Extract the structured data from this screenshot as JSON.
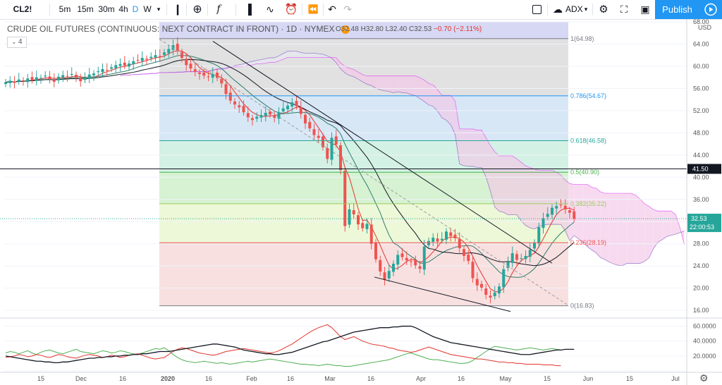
{
  "toolbar": {
    "symbol": "CL2!",
    "intervals": [
      "5m",
      "15m",
      "30m",
      "4h",
      "D",
      "W"
    ],
    "active_interval": "D",
    "compare_label": "ADX",
    "publish_label": "Publish"
  },
  "legend": {
    "title": "CRUDE OIL FUTURES (CONTINUOUS: NEXT CONTRACT IN FRONT) · 1D · NYMEX",
    "badge": "D",
    "o": "O32.48",
    "h": "H32.80",
    "l": "L32.40",
    "c": "C32.53",
    "change": "−0.70 (−2.11%)",
    "indicator_count": "4"
  },
  "price_axis": {
    "currency": "USD",
    "last_price": "32.53",
    "countdown": "22:00:53",
    "hline_price": "41.50"
  },
  "colors": {
    "up": "#26a69a",
    "down": "#ef5350",
    "accent": "#2196f3",
    "cloud_bear": "#f3c6e6",
    "cloud_bull": "#e8e8f2"
  },
  "chart_data": {
    "type": "candlestick",
    "title": "CRUDE OIL FUTURES (CONTINUOUS: NEXT CONTRACT IN FRONT)",
    "ylim": [
      15,
      68
    ],
    "y_ticks": [
      "68.00",
      "64.00",
      "60.00",
      "56.00",
      "52.00",
      "48.00",
      "44.00",
      "40.00",
      "36.00",
      "32.00",
      "28.00",
      "24.00",
      "20.00",
      "16.00"
    ],
    "x_ticks": [
      "15",
      "Dec",
      "16",
      "2020",
      "16",
      "Feb",
      "16",
      "Mar",
      "16",
      "Apr",
      "16",
      "May",
      "15",
      "Jun",
      "15",
      "Jul"
    ],
    "fib_levels": [
      {
        "ratio": "1",
        "price": 64.98,
        "label": "1(64.98)"
      },
      {
        "ratio": "0.786",
        "price": 54.67,
        "label": "0.786(54.67)"
      },
      {
        "ratio": "0.618",
        "price": 46.58,
        "label": "0.618(46.58)"
      },
      {
        "ratio": "0.5",
        "price": 40.9,
        "label": "0.5(40.90)"
      },
      {
        "ratio": "0.382",
        "price": 35.22,
        "label": "0.382(35.22)"
      },
      {
        "ratio": "0.236",
        "price": 28.19,
        "label": "0.236(28.19)"
      },
      {
        "ratio": "0",
        "price": 16.83,
        "label": "0(16.83)"
      }
    ],
    "closes": [
      57.1,
      57.4,
      57.0,
      57.6,
      57.3,
      57.8,
      57.5,
      58.0,
      57.9,
      58.3,
      57.7,
      57.2,
      58.1,
      58.4,
      58.2,
      58.6,
      58.0,
      57.3,
      57.9,
      58.5,
      58.7,
      59.1,
      59.5,
      59.3,
      59.8,
      60.2,
      60.4,
      60.1,
      60.5,
      60.9,
      61.1,
      61.5,
      61.2,
      61.7,
      62.0,
      61.8,
      62.5,
      63.1,
      63.8,
      62.7,
      61.5,
      60.2,
      59.6,
      59.0,
      58.6,
      58.3,
      58.1,
      58.6,
      57.9,
      56.9,
      55.0,
      53.8,
      53.1,
      52.6,
      51.7,
      50.8,
      50.3,
      50.9,
      51.2,
      51.6,
      51.3,
      50.7,
      51.6,
      52.4,
      52.9,
      53.5,
      52.8,
      51.4,
      49.7,
      48.8,
      47.6,
      47.1,
      45.4,
      43.3,
      47.1,
      45.9,
      41.3,
      31.2,
      34.2,
      33.3,
      31.5,
      30.8,
      31.6,
      28.0,
      25.2,
      23.0,
      21.5,
      23.1,
      24.4,
      26.0,
      25.6,
      25.0,
      24.8,
      24.1,
      23.5,
      27.5,
      28.5,
      29.1,
      28.4,
      28.9,
      30.2,
      29.4,
      29.0,
      27.2,
      25.8,
      24.9,
      21.8,
      20.5,
      20.1,
      18.8,
      18.3,
      19.2,
      20.3,
      23.4,
      24.7,
      26.3,
      25.1,
      25.4,
      25.8,
      26.9,
      28.2,
      31.0,
      32.6,
      33.4,
      34.5,
      34.8,
      35.0,
      34.2,
      33.6,
      32.5
    ],
    "adx": [
      20,
      19,
      18,
      17,
      16,
      15,
      14,
      13,
      13,
      12,
      12,
      11,
      11,
      12,
      12,
      13,
      14,
      15,
      16,
      17,
      17,
      18,
      18,
      19,
      19,
      20,
      20,
      21,
      21,
      22,
      22,
      23,
      23,
      24,
      25,
      26,
      26,
      26,
      27,
      28,
      29,
      30,
      31,
      32,
      33,
      34,
      35,
      36,
      36,
      35,
      34,
      33,
      32,
      30,
      28,
      27,
      26,
      25,
      24,
      23,
      23,
      22,
      22,
      23,
      24,
      25,
      27,
      29,
      31,
      33,
      35,
      37,
      39,
      40,
      42,
      44,
      46,
      48,
      50,
      52,
      53,
      54,
      55,
      56,
      57,
      58,
      58,
      58,
      59,
      59,
      60,
      60,
      60,
      58,
      55,
      52,
      49,
      46,
      44,
      42,
      40,
      38,
      37,
      36,
      35,
      34,
      33,
      32,
      31,
      30,
      29,
      28,
      27,
      26,
      25,
      24,
      23,
      22,
      22,
      22,
      23,
      24,
      25,
      26,
      27,
      28,
      28,
      29,
      29,
      29
    ],
    "di_plus": [
      24,
      26,
      25,
      23,
      25,
      27,
      24,
      22,
      25,
      27,
      28,
      26,
      24,
      23,
      25,
      27,
      29,
      26,
      25,
      24,
      23,
      25,
      27,
      26,
      24,
      25,
      27,
      26,
      24,
      23,
      22,
      24,
      26,
      28,
      30,
      29,
      31,
      27,
      22,
      18,
      15,
      13,
      12,
      11,
      12,
      13,
      12,
      11,
      10,
      11,
      10,
      9,
      10,
      11,
      12,
      13,
      12,
      13,
      14,
      15,
      16,
      15,
      14,
      13,
      12,
      11,
      10,
      9,
      9,
      8,
      8,
      7,
      8,
      9,
      8,
      7,
      7,
      6,
      6,
      7,
      8,
      9,
      10,
      11,
      12,
      13,
      14,
      15,
      17,
      19,
      21,
      23,
      24,
      22,
      20,
      18,
      16,
      15,
      15,
      14,
      13,
      12,
      11,
      10,
      10,
      11,
      14,
      18,
      22,
      26,
      30,
      33,
      32,
      31,
      30,
      29,
      28,
      29,
      30,
      31,
      30,
      29,
      28,
      29,
      30,
      29,
      28
    ],
    "di_minus": [
      18,
      19,
      20,
      22,
      21,
      19,
      20,
      22,
      21,
      19,
      18,
      20,
      22,
      21,
      19,
      18,
      17,
      19,
      21,
      22,
      21,
      20,
      18,
      19,
      21,
      20,
      18,
      19,
      21,
      22,
      23,
      21,
      19,
      17,
      16,
      17,
      18,
      22,
      26,
      29,
      31,
      30,
      28,
      26,
      24,
      23,
      22,
      21,
      22,
      24,
      26,
      27,
      28,
      29,
      30,
      29,
      28,
      27,
      26,
      25,
      24,
      25,
      27,
      30,
      33,
      36,
      40,
      44,
      48,
      52,
      55,
      58,
      60,
      62,
      58,
      52,
      46,
      42,
      44,
      46,
      43,
      40,
      38,
      36,
      35,
      34,
      33,
      31,
      30,
      28,
      27,
      26,
      25,
      26,
      28,
      30,
      32,
      30,
      28,
      26,
      24,
      22,
      21,
      20,
      19,
      18,
      17,
      16,
      16,
      15,
      14,
      13,
      12,
      12,
      11,
      11,
      10,
      10,
      9,
      9,
      9,
      9,
      8,
      8,
      8,
      7,
      7
    ]
  }
}
